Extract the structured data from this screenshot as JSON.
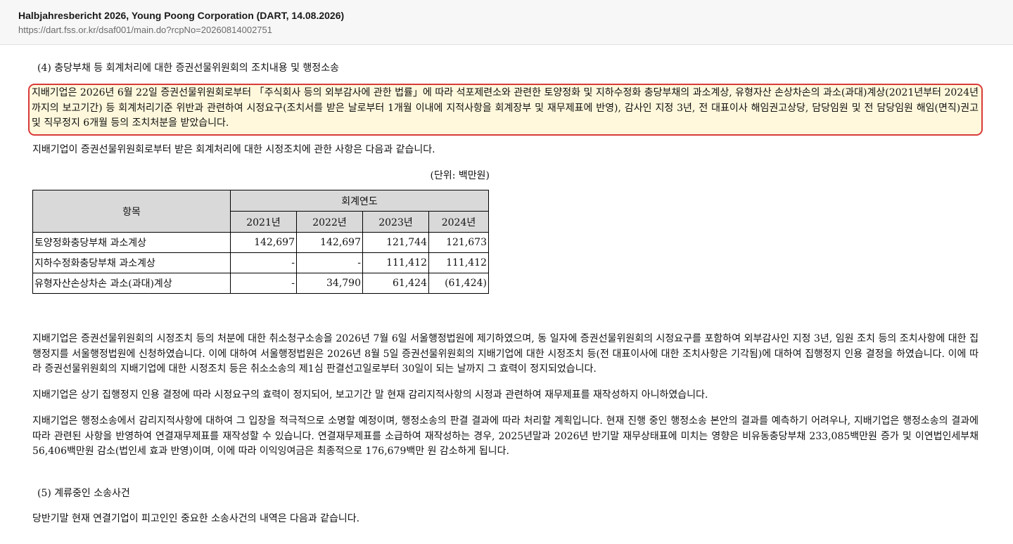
{
  "header": {
    "title": "Halbjahresbericht 2026, Young Poong Corporation (DART, 14.08.2026)",
    "url": "https://dart.fss.or.kr/dsaf001/main.do?rcpNo=20260814002751"
  },
  "section4_heading": "(4) 충당부채 등 회계처리에 대한 증권선물위원회의 조치내용 및 행정소송",
  "highlight_paragraph": "지배기업은 2026년 6월 22일 증권선물위원회로부터 「주식회사 등의 외부감사에 관한 법률」에 따라 석포제련소와 관련한 토양정화 및 지하수정화 충당부채의 과소계상, 유형자산 손상차손의 과소(과대)계상(2021년부터 2024년까지의 보고기간) 등 회계처리기준 위반과 관련하여 시정요구(조치서를 받은 날로부터 1개월 이내에 지적사항을 회계장부 및 재무제표에 반영), 감사인 지정 3년, 전 대표이사 해임권고상당, 담당임원 및 전 담당임원 해임(면직)권고 및 직무정지 6개월 등의 조치처분을 받았습니다.",
  "intro_sentence": "지배기업이 증권선물위원회로부터 받은 회계처리에 대한 시정조치에 관한 사항은 다음과 같습니다.",
  "unit_label": "(단위: 백만원)",
  "table": {
    "item_header": "항목",
    "group_header": "회계연도",
    "years": [
      "2021년",
      "2022년",
      "2023년",
      "2024년"
    ],
    "rows": [
      {
        "label": "토양정화충당부채 과소계상",
        "values": [
          "142,697",
          "142,697",
          "121,744",
          "121,673"
        ]
      },
      {
        "label": "지하수정화충당부채 과소계상",
        "values": [
          "-",
          "-",
          "111,412",
          "111,412"
        ]
      },
      {
        "label": "유형자산손상차손 과소(과대)계상",
        "values": [
          "-",
          "34,790",
          "61,424",
          "(61,424)"
        ]
      }
    ]
  },
  "paragraph_litigation": "지배기업은 증권선물위원회의 시정조치 등의 처분에 대한 취소청구소송을 2026년 7월 6일 서울행정법원에 제기하였으며, 동 일자에 증권선물위원회의 시정요구를 포함하여 외부감사인 지정 3년, 임원 조치 등의 조치사항에 대한 집행정지를 서울행정법원에 신청하였습니다. 이에 대하여 서울행정법원은 2026년 8월 5일 증권선물위원회의 지배기업에 대한 시정조치 등(전 대표이사에 대한 조치사항은 기각됨)에 대하여 집행정지 인용 결정을 하였습니다. 이에 따라 증권선물위원회의 지배기업에 대한 시정조치 등은 취소소송의 제1심 판결선고일로부터 30일이 되는 날까지 그 효력이 정지되었습니다.",
  "paragraph_no_restatement": "지배기업은 상기 집행정지 인용 결정에 따라 시정요구의 효력이 정지되어, 보고기간 말 현재 감리지적사항의 시정과 관련하여 재무제표를 재작성하지 아니하였습니다.",
  "paragraph_outlook": "지배기업은 행정소송에서 감리지적사항에 대하여 그 입장을 적극적으로 소명할 예정이며, 행정소송의 판결 결과에 따라 처리할 계획입니다. 현재 진행 중인 행정소송 본안의 결과를 예측하기 어려우나, 지배기업은 행정소송의 결과에 따라 관련된 사항을 반영하여 연결재무제표를 재작성할 수 있습니다. 연결재무제표를 소급하여 재작성하는 경우, 2025년말과 2026년 반기말 재무상태표에 미치는 영향은 비유동충당부채 233,085백만원 증가 및 이연법인세부채 56,406백만원 감소(법인세 효과 반영)이며, 이에 따라 이익잉여금은 최종적으로 176,679백만 원 감소하게 됩니다.",
  "section5_heading": "(5) 계류중인 소송사건",
  "section5_sentence": "당반기말 현재 연결기업이 피고인인 중요한 소송사건의 내역은 다음과 같습니다."
}
